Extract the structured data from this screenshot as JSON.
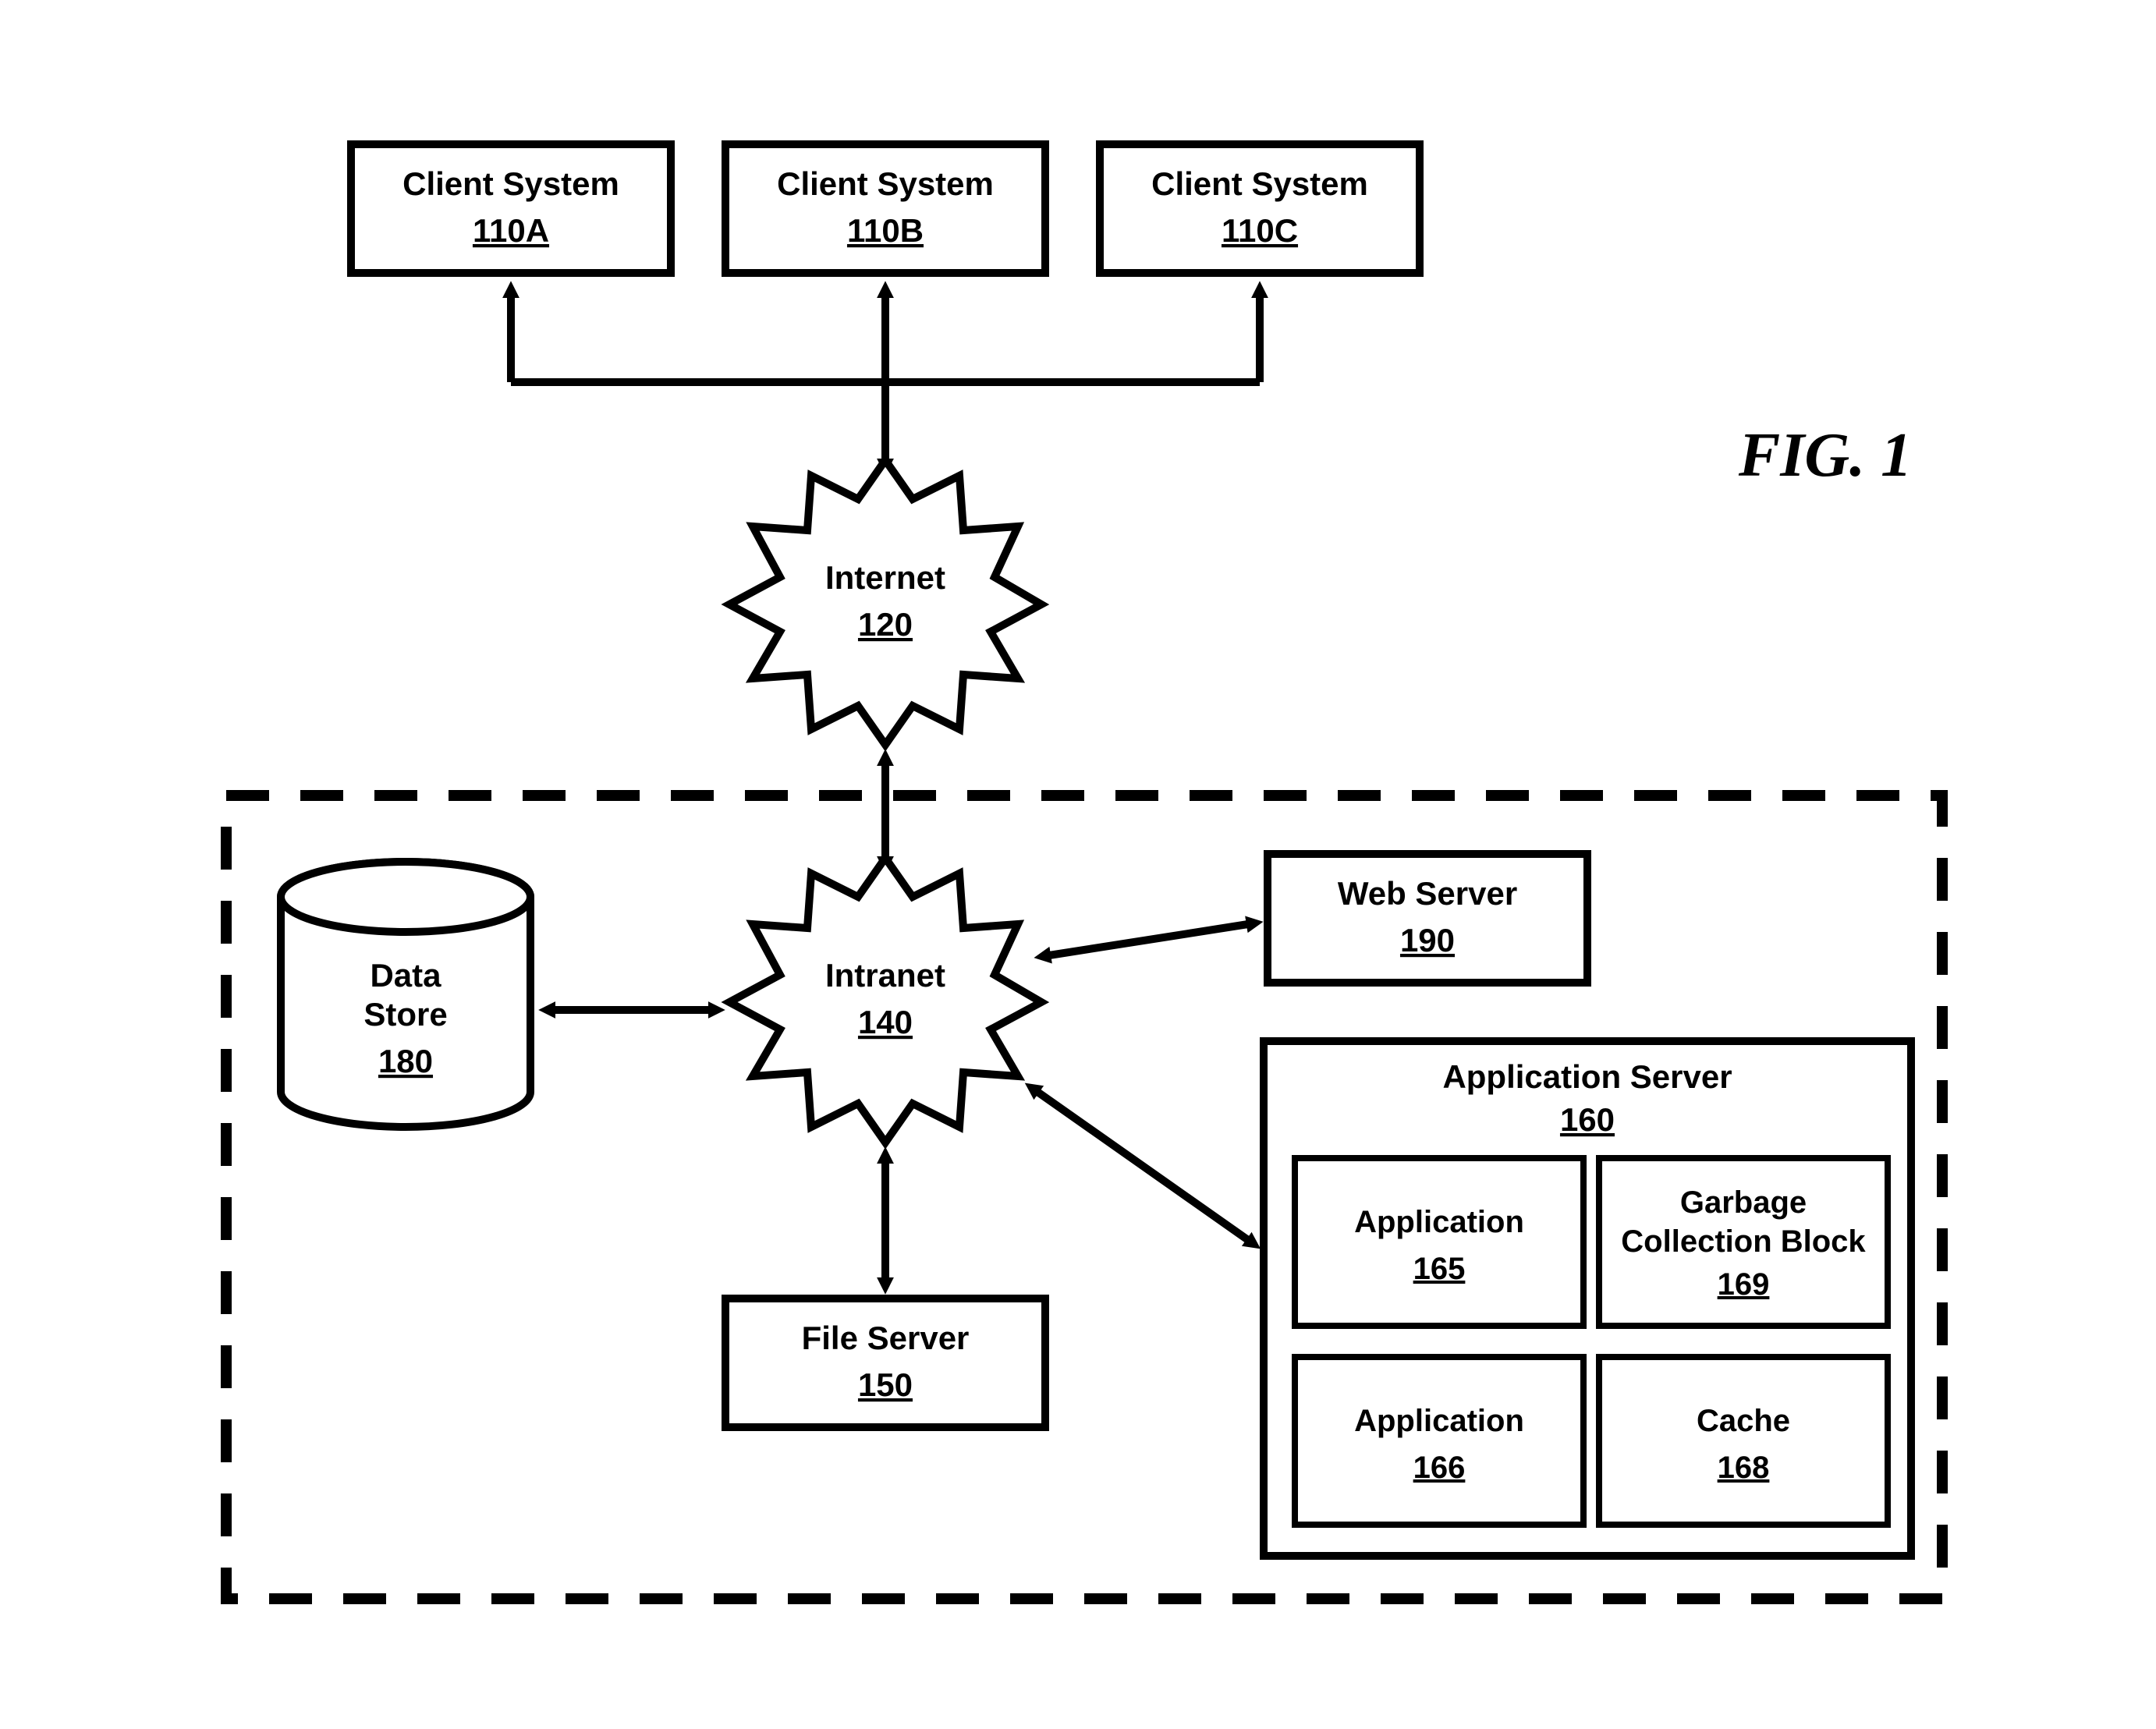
{
  "figure_label": "FIG.  1",
  "clients": [
    {
      "title": "Client System",
      "ref": "110A"
    },
    {
      "title": "Client System",
      "ref": "110B"
    },
    {
      "title": "Client System",
      "ref": "110C"
    }
  ],
  "internet": {
    "title": "Internet",
    "ref": "120"
  },
  "intranet": {
    "title": "Intranet",
    "ref": "140"
  },
  "data_store": {
    "title1": "Data",
    "title2": "Store",
    "ref": "180"
  },
  "file_server": {
    "title": "File Server",
    "ref": "150"
  },
  "web_server": {
    "title": "Web Server",
    "ref": "190"
  },
  "app_server": {
    "title": "Application Server",
    "ref": "160"
  },
  "app1": {
    "title": "Application",
    "ref": "165"
  },
  "app2": {
    "title": "Application",
    "ref": "166"
  },
  "gc": {
    "title1": "Garbage",
    "title2": "Collection Block",
    "ref": "169"
  },
  "cache": {
    "title": "Cache",
    "ref": "168"
  }
}
